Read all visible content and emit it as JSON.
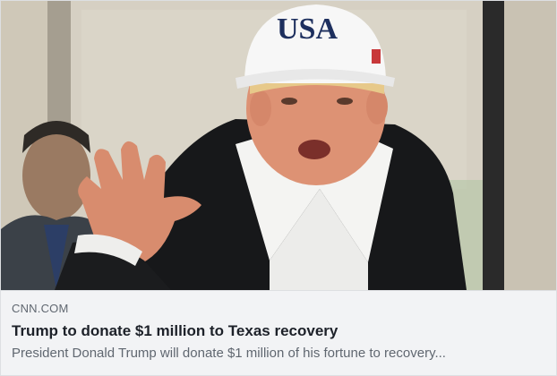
{
  "link_preview": {
    "domain": "CNN.COM",
    "headline": "Trump to donate $1 million to Texas recovery",
    "description": "President Donald Trump will donate $1 million of his fortune to recovery...",
    "photo": {
      "cap_text": "USA"
    }
  },
  "colors": {
    "meta_background": "#f2f3f5",
    "headline_text": "#1d2129",
    "secondary_text": "#606770",
    "border": "#dddfe2"
  }
}
